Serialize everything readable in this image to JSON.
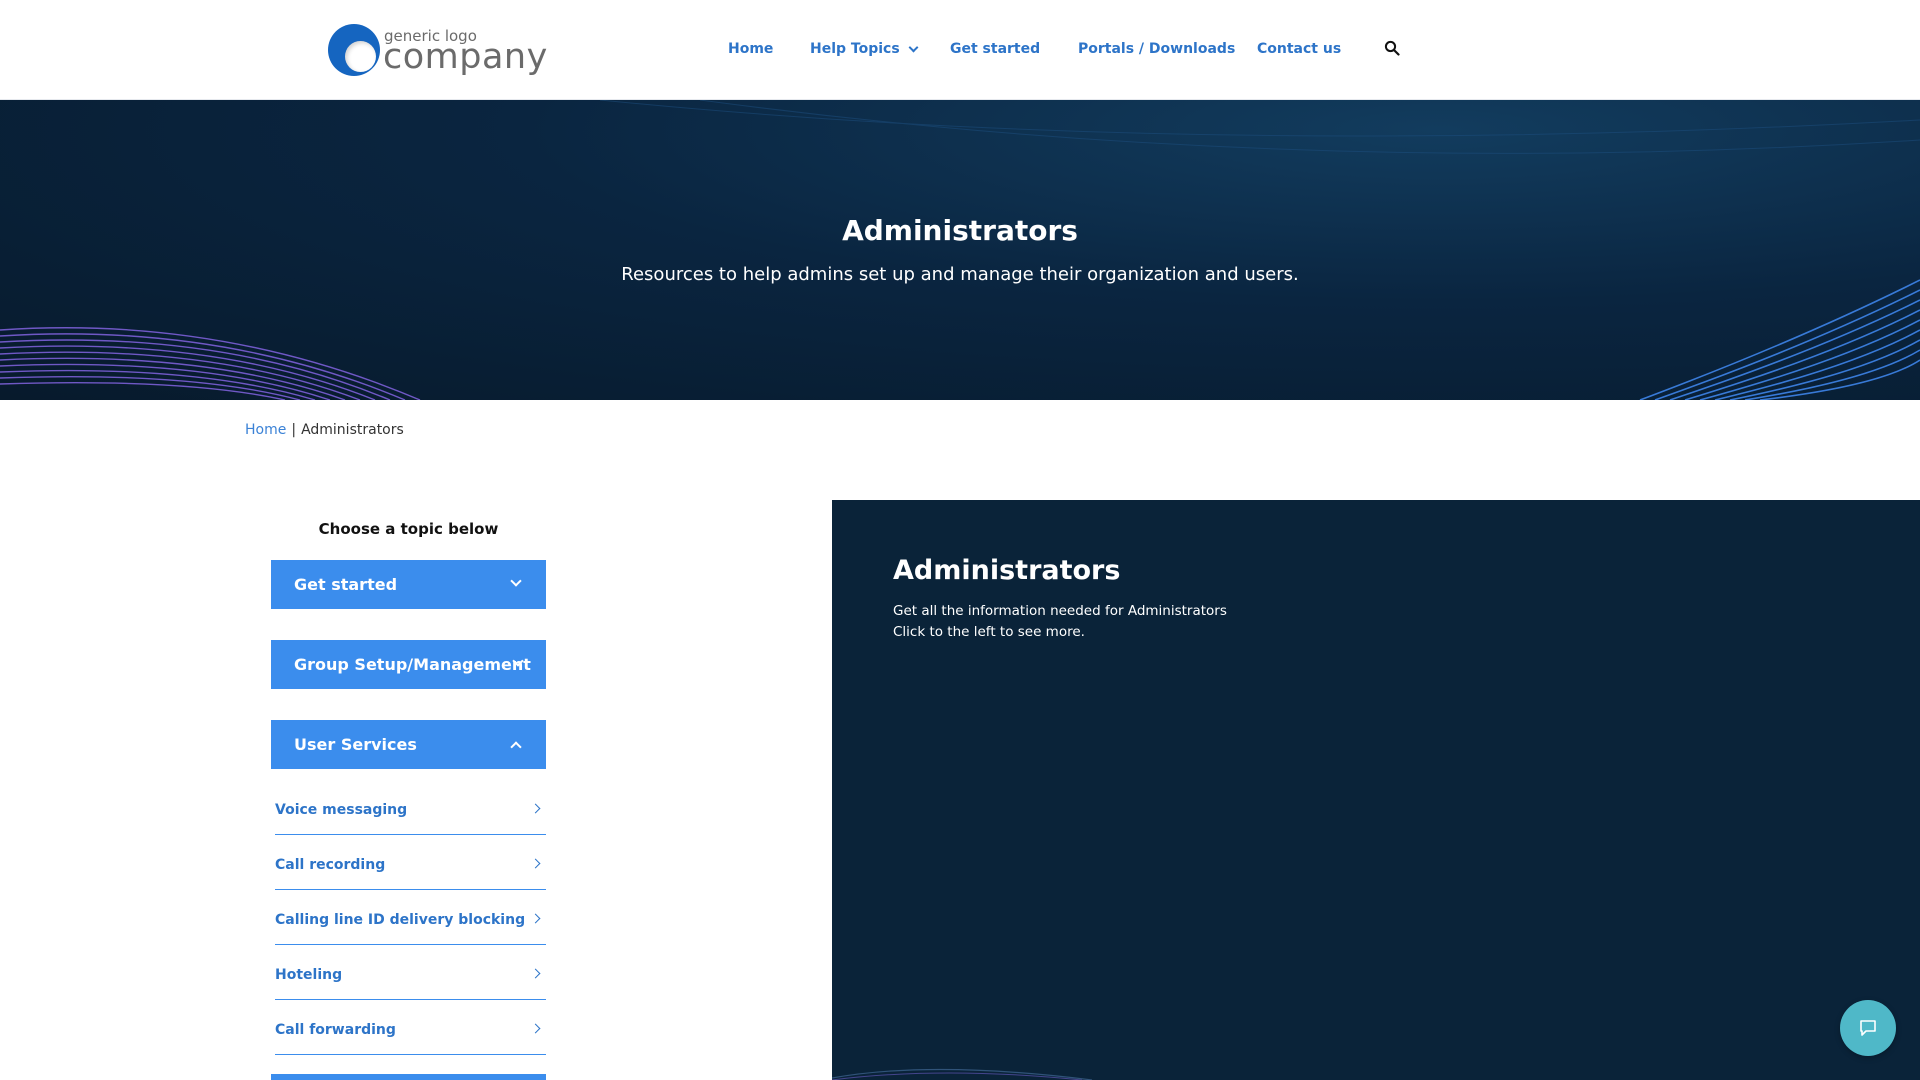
{
  "header": {
    "logo": {
      "small_text": "generic logo",
      "big_text": "company"
    },
    "nav": [
      {
        "label": "Home"
      },
      {
        "label": "Help Topics",
        "has_dropdown": true
      },
      {
        "label": "Get started"
      },
      {
        "label": "Portals / Downloads"
      },
      {
        "label": "Contact us"
      }
    ],
    "search_icon": "search-icon"
  },
  "hero": {
    "title": "Administrators",
    "subtitle": "Resources to help admins set up and manage their organization and users."
  },
  "breadcrumb": {
    "home": "Home",
    "separator": "|",
    "current": "Administrators"
  },
  "sidebar": {
    "heading": "Choose a topic below",
    "accordions": [
      {
        "label": "Get started",
        "expanded": false
      },
      {
        "label": "Group Setup/Management",
        "expanded": false
      },
      {
        "label": "User Services",
        "expanded": true
      }
    ],
    "items": [
      {
        "label": "Voice messaging"
      },
      {
        "label": "Call recording"
      },
      {
        "label": "Calling line ID delivery blocking"
      },
      {
        "label": "Hoteling"
      },
      {
        "label": "Call forwarding"
      }
    ]
  },
  "panel": {
    "title": "Administrators",
    "line1": "Get all the information needed for Administrators",
    "line2": "Click to the left to see more."
  },
  "chat": {
    "icon": "chat-bubble-icon"
  },
  "colors": {
    "accent": "#3b8ded",
    "link": "#2d74c8",
    "hero_bg": "#0a2540",
    "panel_bg": "#0a2339",
    "chat_bg": "#4fb8c8"
  }
}
